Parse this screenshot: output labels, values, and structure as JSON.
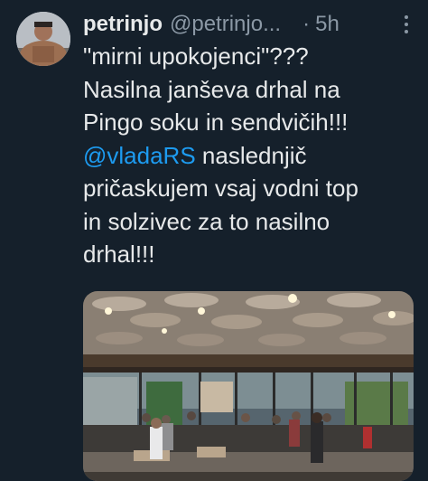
{
  "author": {
    "display_name": "petrinjo",
    "handle": "@petrinjo...",
    "avatar_icon": "person-avatar-icon"
  },
  "meta": {
    "separator": "·",
    "time": "5h",
    "more_icon": "more-options-icon"
  },
  "tweet": {
    "line1": "\"mirni upokojenci\"???",
    "line2": "Nasilna janševa drhal na",
    "line3": "Pingo soku in sendvičih!!!",
    "mention": "@vladaRS",
    "line4_rest": " naslednjič",
    "line5": "pričaskujem vsaj vodni top",
    "line6": "in solzivec za to nasilno",
    "line7": "drhal!!!"
  },
  "colors": {
    "background": "#15202b",
    "text": "#e7e9ea",
    "secondary": "#8b98a5",
    "link": "#1d9bf0"
  }
}
